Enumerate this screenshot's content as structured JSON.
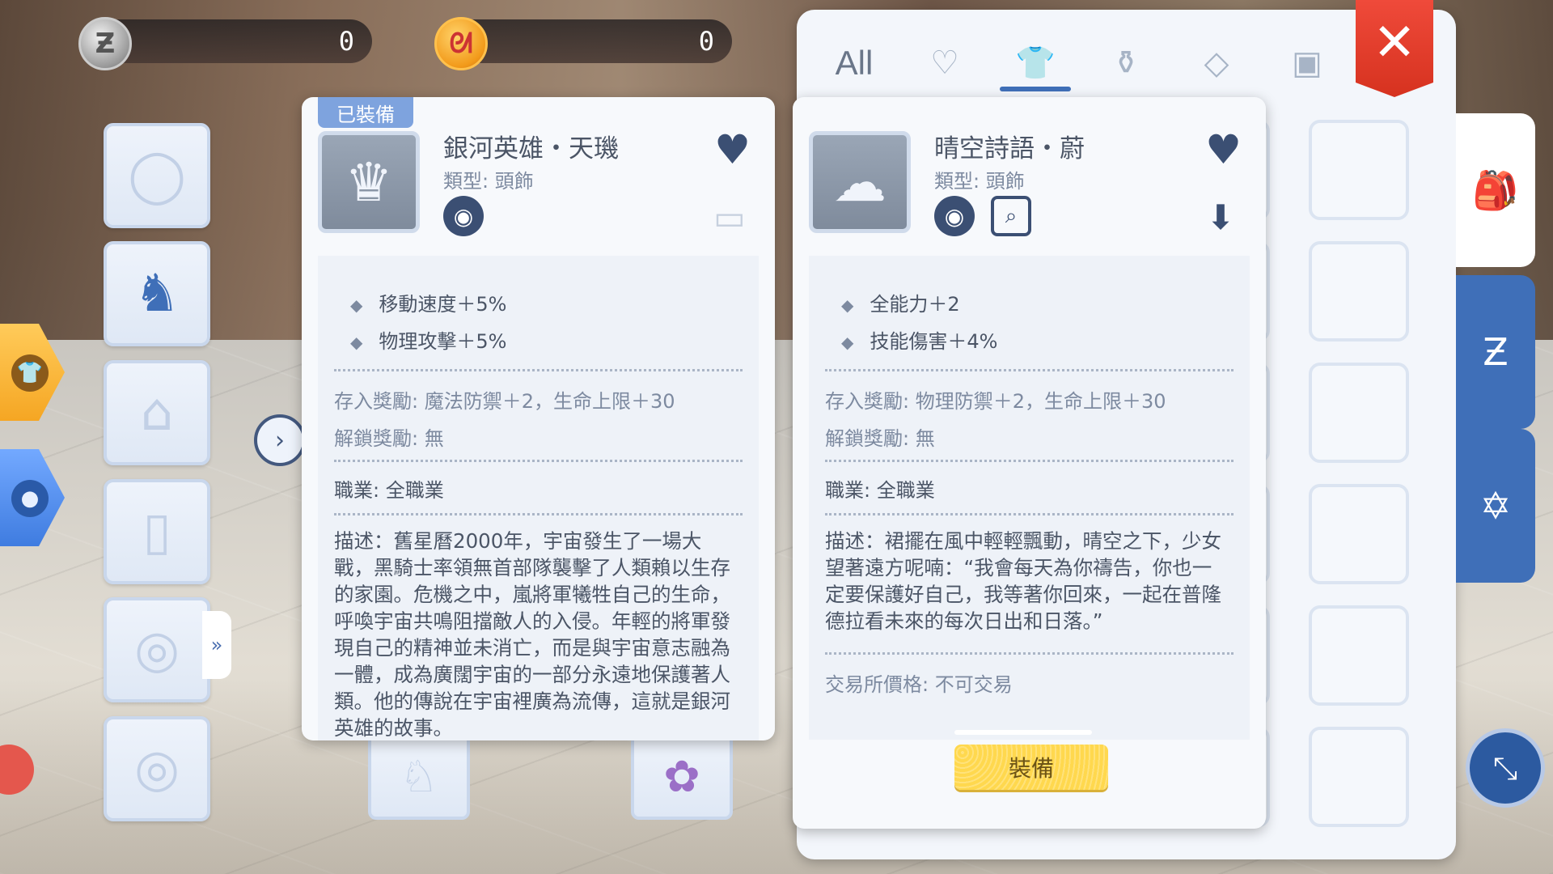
{
  "currencies": [
    {
      "icon": "zeny-coin-icon",
      "value": "0"
    },
    {
      "icon": "cat-coin-icon",
      "value": "0"
    }
  ],
  "inventory_tabs": [
    {
      "label": "All",
      "icon": null
    },
    {
      "label": "",
      "icon": "heart-outline-icon"
    },
    {
      "label": "",
      "icon": "shirt-icon",
      "active": true
    },
    {
      "label": "",
      "icon": "bottle-icon"
    },
    {
      "label": "",
      "icon": "diamond-icon"
    },
    {
      "label": "",
      "icon": "card-icon"
    }
  ],
  "side_tabs": [
    "backpack-icon",
    "zeny-bag-icon",
    "hexagram-icon"
  ],
  "equipped_item": {
    "tag": "已裝備",
    "name": "銀河英雄・天璣",
    "type_key": "類型:",
    "type_value": "頭飾",
    "stats": [
      "移動速度＋5%",
      "物理攻擊＋5%"
    ],
    "deposit_key": "存入獎勵:",
    "deposit_value": "魔法防禦＋2，生命上限＋30",
    "unlock_key": "解鎖獎勵:",
    "unlock_value": "無",
    "job_key": "職業:",
    "job_value": "全職業",
    "description": "描述：舊星曆2000年，宇宙發生了一場大戰，黑騎士率領無首部隊襲擊了人類賴以生存的家園。危機之中，嵐將軍犧牲自己的生命，呼喚宇宙共鳴阻擋敵人的入侵。年輕的將軍發現自己的精神並未消亡，而是與宇宙意志融為一體，成為廣闊宇宙的一部分永遠地保護著人類。他的傳說在宇宙裡廣為流傳，這就是銀河英雄的故事。"
  },
  "preview_item": {
    "name": "晴空詩語・蔚",
    "type_key": "類型:",
    "type_value": "頭飾",
    "stats": [
      "全能力＋2",
      "技能傷害＋4%"
    ],
    "deposit_key": "存入獎勵:",
    "deposit_value": "物理防禦＋2，生命上限＋30",
    "unlock_key": "解鎖獎勵:",
    "unlock_value": "無",
    "job_key": "職業:",
    "job_value": "全職業",
    "description": "描述：裙擺在風中輕輕飄動，晴空之下，少女望著遠方呢喃：“我會每天為你禱告，你也一定要保護好自己，我等著你回來，一起在普隆德拉看未來的每次日出和日落。”",
    "trade_key": "交易所價格:",
    "trade_value": "不可交易",
    "equip_button": "裝備"
  },
  "colors": {
    "accent": "#3f6fb8",
    "close": "#e0402e",
    "equip_button": "#ffd84e"
  }
}
